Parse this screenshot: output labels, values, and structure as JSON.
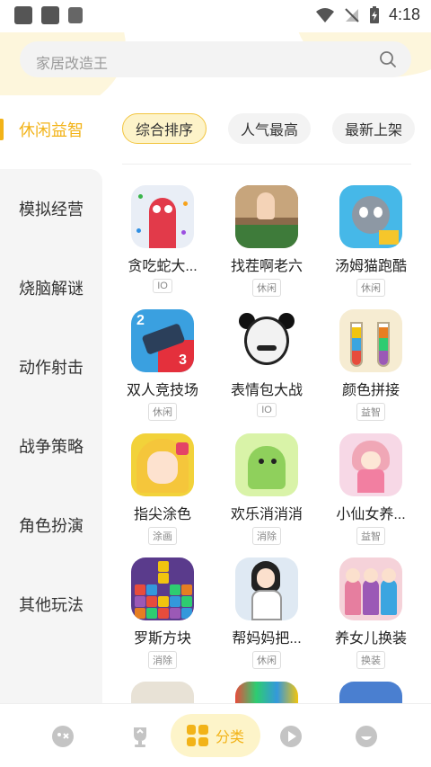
{
  "status_bar": {
    "time": "4:18"
  },
  "search": {
    "placeholder": "家居改造王"
  },
  "categories": [
    {
      "label": "休闲益智",
      "active": true
    },
    {
      "label": "模拟经营"
    },
    {
      "label": "烧脑解谜"
    },
    {
      "label": "动作射击"
    },
    {
      "label": "战争策略"
    },
    {
      "label": "角色扮演"
    },
    {
      "label": "其他玩法"
    }
  ],
  "sorts": [
    {
      "label": "综合排序",
      "active": true
    },
    {
      "label": "人气最高"
    },
    {
      "label": "最新上架"
    }
  ],
  "apps": [
    {
      "name": "贪吃蛇大...",
      "tag": "IO"
    },
    {
      "name": "找茬啊老六",
      "tag": "休闲"
    },
    {
      "name": "汤姆猫跑酷",
      "tag": "休闲"
    },
    {
      "name": "双人竞技场",
      "tag": "休闲"
    },
    {
      "name": "表情包大战",
      "tag": "IO"
    },
    {
      "name": "颜色拼接",
      "tag": "益智"
    },
    {
      "name": "指尖涂色",
      "tag": "涂画"
    },
    {
      "name": "欢乐消消消",
      "tag": "消除"
    },
    {
      "name": "小仙女养...",
      "tag": "益智"
    },
    {
      "name": "罗斯方块",
      "tag": "消除"
    },
    {
      "name": "帮妈妈把...",
      "tag": "休闲"
    },
    {
      "name": "养女儿换装",
      "tag": "换装"
    }
  ],
  "duo_icon": {
    "n1": "2",
    "n2": "3"
  },
  "bottom_nav": {
    "items": [
      {
        "icon": "game-controller-icon"
      },
      {
        "icon": "trophy-icon"
      },
      {
        "icon": "category-grid-icon",
        "label": "分类",
        "active": true
      },
      {
        "icon": "play-icon"
      },
      {
        "icon": "profile-icon"
      }
    ]
  },
  "accent_color": "#f2b318"
}
